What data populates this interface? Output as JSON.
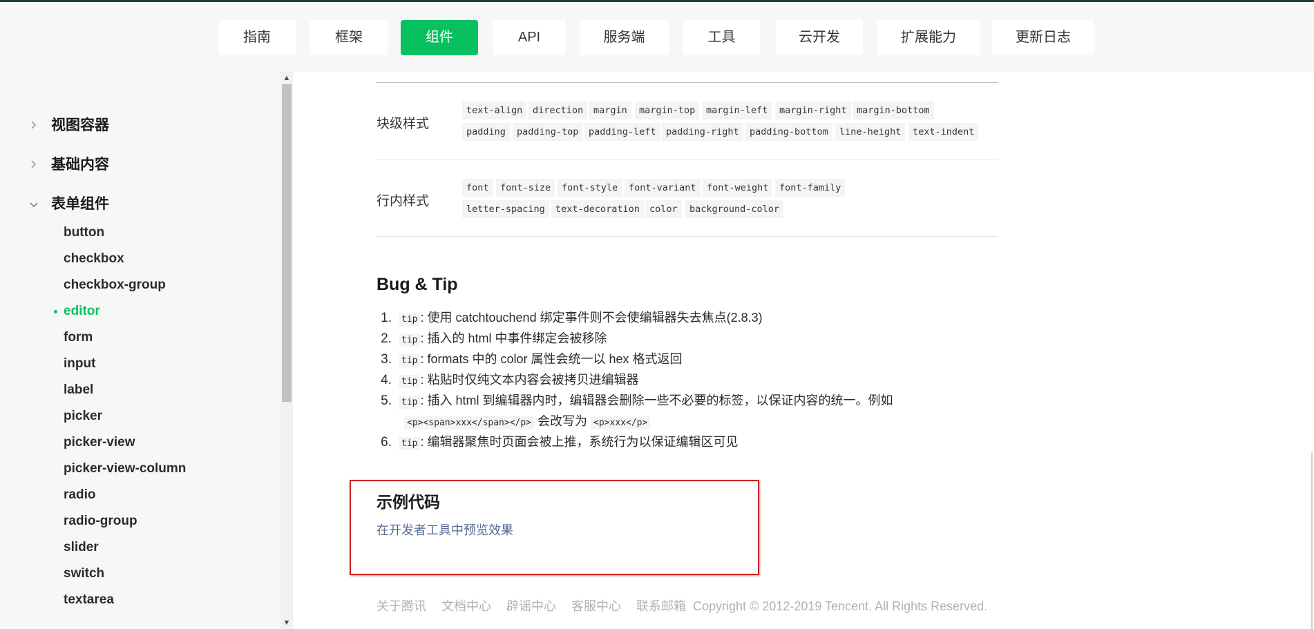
{
  "nav": {
    "items": [
      {
        "label": "指南"
      },
      {
        "label": "框架"
      },
      {
        "label": "组件",
        "active": true
      },
      {
        "label": "API"
      },
      {
        "label": "服务端"
      },
      {
        "label": "工具"
      },
      {
        "label": "云开发"
      },
      {
        "label": "扩展能力"
      },
      {
        "label": "更新日志"
      }
    ],
    "active_color": "#07c160"
  },
  "sidebar": {
    "groups": [
      {
        "label": "视图容器",
        "expanded": false
      },
      {
        "label": "基础内容",
        "expanded": false
      },
      {
        "label": "表单组件",
        "expanded": true
      }
    ],
    "items": [
      {
        "label": "button"
      },
      {
        "label": "checkbox"
      },
      {
        "label": "checkbox-group"
      },
      {
        "label": "editor",
        "active": true
      },
      {
        "label": "form"
      },
      {
        "label": "input"
      },
      {
        "label": "label"
      },
      {
        "label": "picker"
      },
      {
        "label": "picker-view"
      },
      {
        "label": "picker-view-column"
      },
      {
        "label": "radio"
      },
      {
        "label": "radio-group"
      },
      {
        "label": "slider"
      },
      {
        "label": "switch"
      },
      {
        "label": "textarea"
      }
    ]
  },
  "styles_table": {
    "rows": [
      {
        "label": "块级样式",
        "tags": [
          "text-align",
          "direction",
          "margin",
          "margin-top",
          "margin-left",
          "margin-right",
          "margin-bottom",
          "padding",
          "padding-top",
          "padding-left",
          "padding-right",
          "padding-bottom",
          "line-height",
          "text-indent"
        ]
      },
      {
        "label": "行内样式",
        "tags": [
          "font",
          "font-size",
          "font-style",
          "font-variant",
          "font-weight",
          "font-family",
          "letter-spacing",
          "text-decoration",
          "color",
          "background-color"
        ]
      }
    ]
  },
  "bug_tip": {
    "title": "Bug & Tip",
    "tips": [
      {
        "num": "1.",
        "tag": "tip",
        "text": ": 使用 catchtouchend 绑定事件则不会使编辑器失去焦点(2.8.3)"
      },
      {
        "num": "2.",
        "tag": "tip",
        "text": ": 插入的 html 中事件绑定会被移除"
      },
      {
        "num": "3.",
        "tag": "tip",
        "text": ": formats 中的 color 属性会统一以 hex 格式返回"
      },
      {
        "num": "4.",
        "tag": "tip",
        "text": ": 粘贴时仅纯文本内容会被拷贝进编辑器"
      },
      {
        "num": "5.",
        "tag": "tip",
        "text": ": 插入 html 到编辑器内时，编辑器会删除一些不必要的标签，以保证内容的统一。例如"
      },
      {
        "num": "6.",
        "tag": "tip",
        "text": ": 编辑器聚焦时页面会被上推，系统行为以保证编辑区可见"
      }
    ],
    "tip5_continuation": {
      "code1": "<p><span>xxx</span></p>",
      "mid": " 会改写为 ",
      "code2": "<p>xxx</p>"
    }
  },
  "example": {
    "title": "示例代码",
    "link": "在开发者工具中预览效果",
    "highlight_color": "#d01f1f"
  },
  "footer": {
    "links": [
      "关于腾讯",
      "文档中心",
      "辟谣中心",
      "客服中心",
      "联系邮箱"
    ],
    "copyright": "Copyright © 2012-2019 Tencent. All Rights Reserved."
  }
}
